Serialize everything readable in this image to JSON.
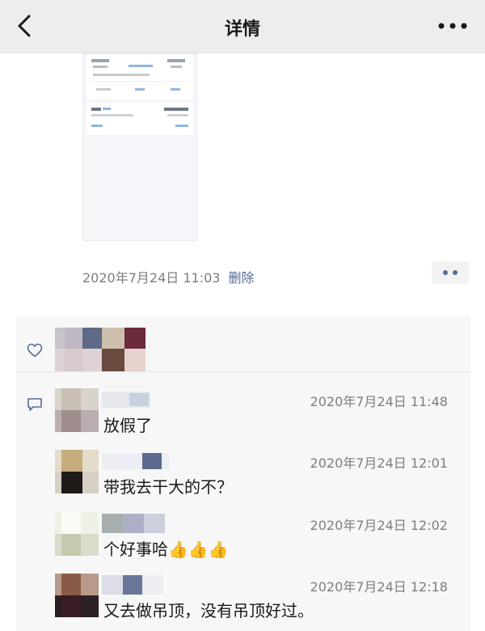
{
  "nav": {
    "title": "详情",
    "back_icon": "chevron-left-icon",
    "more_icon": "more-horizontal-icon"
  },
  "post": {
    "date": "2020年7月24日 11:03",
    "delete_label": "删除"
  },
  "interactions": {
    "like_icon": "heart-icon",
    "comment_icon": "comment-bubble-icon",
    "link_color": "#576b95",
    "comments": [
      {
        "time": "2020年7月24日 11:48",
        "text": "放假了"
      },
      {
        "time": "2020年7月24日 12:01",
        "text": "带我去干大的不？"
      },
      {
        "time": "2020年7月24日 12:02",
        "text": "个好事哈👍👍👍"
      },
      {
        "time": "2020年7月24日 12:18",
        "text": "又去做吊顶，没有吊顶好过。"
      }
    ]
  }
}
